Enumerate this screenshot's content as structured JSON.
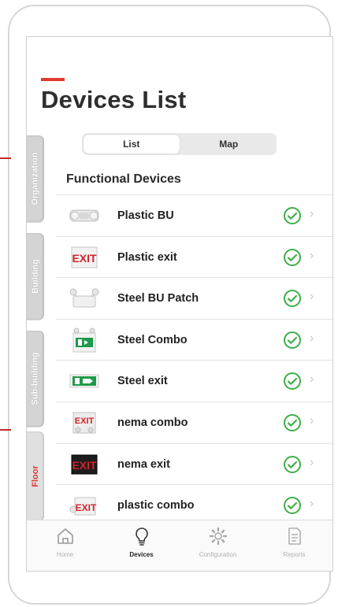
{
  "app": {
    "title": "Devices List"
  },
  "segments": [
    {
      "label": "List",
      "active": true
    },
    {
      "label": "Map",
      "active": false
    }
  ],
  "section": {
    "title": "Functional Devices"
  },
  "devices": [
    {
      "label": "Plastic BU",
      "thumb": "emergency-light-icon",
      "status": "ok"
    },
    {
      "label": "Plastic exit",
      "thumb": "exit-sign-icon",
      "status": "ok"
    },
    {
      "label": "Steel BU Patch",
      "thumb": "twin-head-light-icon",
      "status": "ok"
    },
    {
      "label": "Steel Combo",
      "thumb": "running-man-combo-icon",
      "status": "ok"
    },
    {
      "label": "Steel exit",
      "thumb": "running-man-exit-icon",
      "status": "ok"
    },
    {
      "label": "nema combo",
      "thumb": "exit-combo-icon",
      "status": "ok"
    },
    {
      "label": "nema exit",
      "thumb": "black-exit-sign-icon",
      "status": "ok"
    },
    {
      "label": "plastic combo",
      "thumb": "exit-combo-lamp-icon",
      "status": "ok"
    }
  ],
  "side_tabs": [
    {
      "label": "Organization",
      "active": false
    },
    {
      "label": "Building",
      "active": false
    },
    {
      "label": "Sub-building",
      "active": false
    },
    {
      "label": "Floor",
      "active": true
    }
  ],
  "tabbar": [
    {
      "label": "Home",
      "icon": "home-icon",
      "active": false
    },
    {
      "label": "Devices",
      "icon": "lightbulb-icon",
      "active": true
    },
    {
      "label": "Configuration",
      "icon": "gear-icon",
      "active": false
    },
    {
      "label": "Reports",
      "icon": "document-icon",
      "active": false
    }
  ],
  "colors": {
    "accent": "#e23a31",
    "status_ok": "#3fae49",
    "text": "#222222",
    "tab_inactive": "#b0b0b0"
  }
}
